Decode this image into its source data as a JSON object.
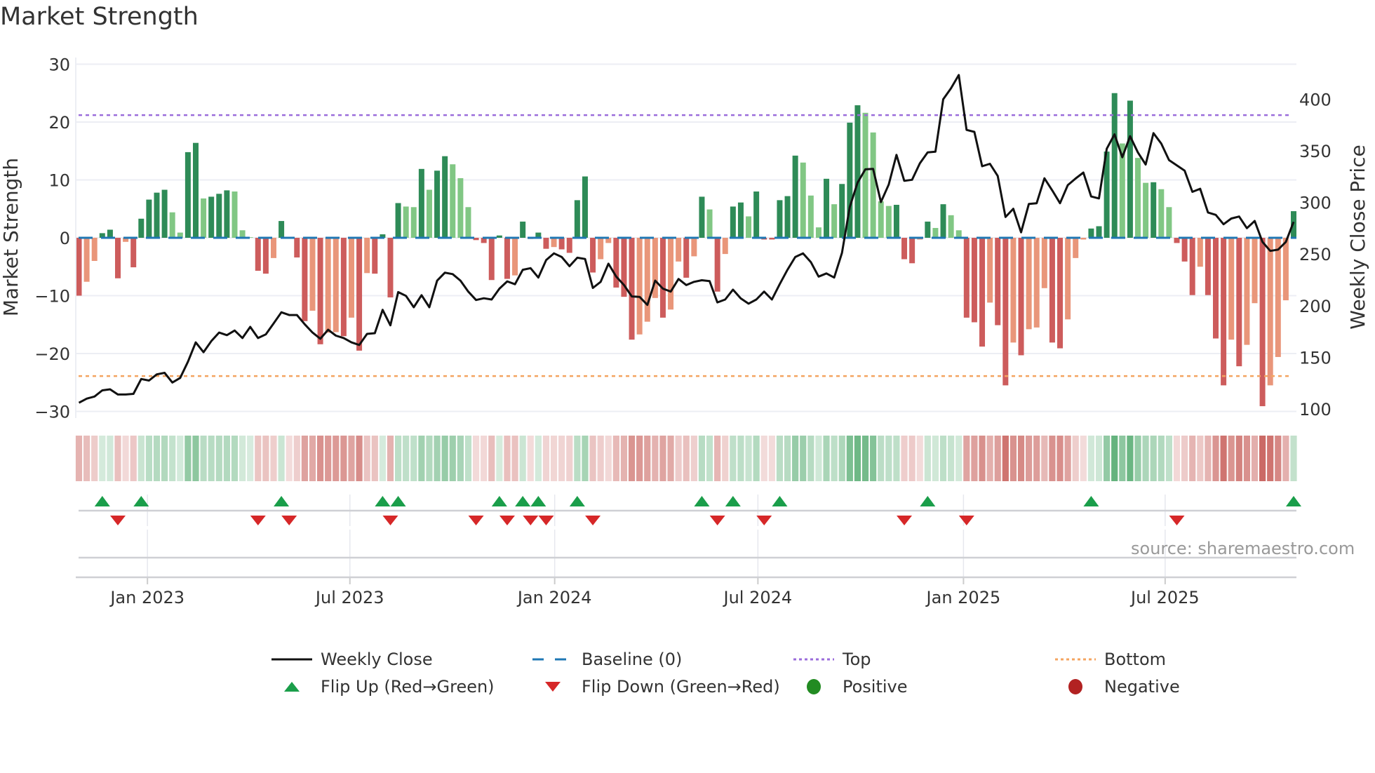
{
  "title": "Market Strength",
  "source": "source: sharemaestro.com",
  "colors": {
    "pos_strong": "#2e8b57",
    "pos_weak": "#81c784",
    "neg_strong": "#cd5c5c",
    "neg_weak": "#e9967a",
    "baseline": "#1f77b4",
    "top": "#9b6ddb",
    "bottom": "#f4a460",
    "flip_up": "#1a9e4a",
    "flip_down": "#d62728",
    "positive": "#228b22",
    "negative": "#b22222",
    "price": "#111111"
  },
  "legend": [
    {
      "label": "Weekly Close",
      "symbol": "solid-line"
    },
    {
      "label": "Baseline (0)",
      "symbol": "dashed-line"
    },
    {
      "label": "Top",
      "symbol": "dotted-line"
    },
    {
      "label": "Bottom",
      "symbol": "dotted-line"
    },
    {
      "label": "Flip Up (Red→Green)",
      "symbol": "triangle-up"
    },
    {
      "label": "Flip Down (Green→Red)",
      "symbol": "triangle-down"
    },
    {
      "label": "Positive",
      "symbol": "circle"
    },
    {
      "label": "Negative",
      "symbol": "circle"
    }
  ],
  "chart_data": {
    "type": "bar",
    "title": "Market Strength",
    "ylabel": "Market Strength",
    "y2label": "Weekly Close Price",
    "ylim": [
      -30,
      30
    ],
    "y2lim": [
      100,
      400
    ],
    "yticks": [
      "30",
      "20",
      "10",
      "0",
      "−10",
      "−20",
      "−30"
    ],
    "ytick_values": [
      30,
      20,
      10,
      0,
      -10,
      -20,
      -30
    ],
    "y2ticks": [
      "400",
      "350",
      "300",
      "250",
      "200",
      "150",
      "100"
    ],
    "y2tick_values": [
      400,
      350,
      300,
      250,
      200,
      150,
      100
    ],
    "xticks": [
      {
        "label": "Jan 2023",
        "week_index": 8.8
      },
      {
        "label": "Jul 2023",
        "week_index": 34.8
      },
      {
        "label": "Jan 2024",
        "week_index": 61.1
      },
      {
        "label": "Jul 2024",
        "week_index": 87.2
      },
      {
        "label": "Jan 2025",
        "week_index": 113.6
      },
      {
        "label": "Jul 2025",
        "week_index": 139.5
      }
    ],
    "top_level": 21.2,
    "bottom_level": -23.9,
    "baseline": 0,
    "grid": true,
    "legend_position": "bottom",
    "strength": [
      -10,
      -7.6,
      -4,
      0.8,
      1.4,
      -7,
      -0.7,
      -5.1,
      3.3,
      6.6,
      7.8,
      8.3,
      4.4,
      0.9,
      14.8,
      16.4,
      6.8,
      7.1,
      7.6,
      8.2,
      8.0,
      1.3,
      0.1,
      -5.7,
      -6.2,
      -3.5,
      2.9,
      -0.1,
      -3.4,
      -14.4,
      -12.6,
      -18.4,
      -16.4,
      -16.3,
      -17,
      -13.8,
      -19.5,
      -6.1,
      -6.2,
      0.6,
      -10.3,
      6.0,
      5.4,
      5.3,
      11.9,
      8.3,
      11.6,
      14.1,
      12.7,
      10.3,
      5.3,
      -0.4,
      -0.9,
      -7.3,
      0.4,
      -7.1,
      -6.5,
      2.8,
      -0.2,
      0.9,
      -1.9,
      -1.6,
      -2.0,
      -2.6,
      6.5,
      10.6,
      -6.0,
      -3.7,
      -0.9,
      -8.6,
      -10.2,
      -17.6,
      -16.7,
      -14.5,
      -10.4,
      -13.8,
      -12.4,
      -4.1,
      -6.9,
      -3.2,
      7.1,
      4.9,
      -9.3,
      -2.8,
      5.4,
      6.1,
      3.7,
      8.0,
      -0.3,
      -0.3,
      6.5,
      7.2,
      14.2,
      13.0,
      7.3,
      1.8,
      10.2,
      5.8,
      9.3,
      19.9,
      22.9,
      21.6,
      18.2,
      6.3,
      5.5,
      5.7,
      -3.7,
      -4.4,
      -0.3,
      2.8,
      1.7,
      5.8,
      3.9,
      1.3,
      -13.8,
      -14.6,
      -18.8,
      -11.2,
      -15.1,
      -25.5,
      -18.1,
      -20.3,
      -15.8,
      -15.5,
      -8.7,
      -18.1,
      -19.1,
      -14.1,
      -3.5,
      -0.3,
      1.6,
      2.0,
      14.9,
      25.0,
      16.3,
      23.7,
      13.8,
      9.5,
      9.6,
      8.4,
      5.3,
      -0.9,
      -4.1,
      -9.9,
      -5.0,
      -9.9,
      -17.4,
      -25.5,
      -17.6,
      -22.2,
      -18.5,
      -11.3,
      -29.1,
      -25.5,
      -20.6,
      -10.8,
      4.6
    ],
    "weekly_close": [
      106,
      110,
      112,
      118,
      119,
      114,
      114,
      114.6,
      129,
      127.5,
      133.5,
      135,
      125.6,
      130,
      145.7,
      164.5,
      155,
      165.7,
      174,
      171.5,
      176,
      168.7,
      179.5,
      168.7,
      172.2,
      182.8,
      193.6,
      191,
      191,
      182,
      174,
      168,
      176.7,
      171,
      168.7,
      164.5,
      162,
      172.7,
      173.4,
      196,
      181,
      213.2,
      209.5,
      198.5,
      210.2,
      198.5,
      224.3,
      232,
      230.6,
      224.3,
      213.7,
      205.5,
      207.2,
      206,
      216.5,
      223.6,
      220.8,
      234.8,
      236.4,
      227.3,
      244.2,
      250.7,
      247.2,
      238.3,
      246.5,
      245.3,
      217.2,
      223.1,
      240.7,
      228.2,
      220,
      209,
      208.6,
      200.8,
      224.3,
      216.5,
      213.7,
      225.9,
      220,
      223.1,
      224.7,
      223.8,
      203.2,
      206,
      215.6,
      207.1,
      202,
      206,
      213.7,
      206,
      220.8,
      234.8,
      247.2,
      250.7,
      242.3,
      228.2,
      231.3,
      227.3,
      251.2,
      295.7,
      319.2,
      332.1,
      332.5,
      300.4,
      317.3,
      346.1,
      321,
      322,
      337.9,
      348.5,
      349.2,
      400,
      410.6,
      423.5,
      370.3,
      368.4,
      335.1,
      337.5,
      325.7,
      285.9,
      293.9,
      271.1,
      298.6,
      299.3,
      323.4,
      311.7,
      299.3,
      316.8,
      323.2,
      329,
      305.8,
      303.9,
      352,
      366,
      343.8,
      364.2,
      348.5,
      336.8,
      367.2,
      357.1,
      341,
      336,
      330.9,
      310.3,
      313.3,
      290.3,
      288,
      278.9,
      284.5,
      286.4,
      275.1,
      282.1,
      261.8,
      253.1,
      254.3,
      261.8,
      281.2
    ]
  }
}
